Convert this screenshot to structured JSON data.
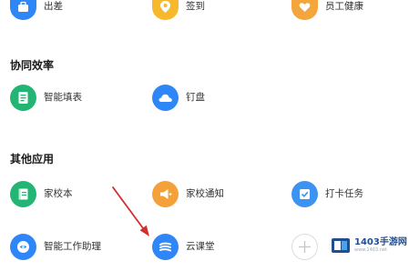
{
  "top_row": {
    "items": [
      {
        "label": "出差",
        "icon": "suitcase-icon",
        "color": "#2f86f6"
      },
      {
        "label": "签到",
        "icon": "location-pin-icon",
        "color": "#f5b92b"
      },
      {
        "label": "员工健康",
        "icon": "heart-shield-icon",
        "color": "#f4a63c"
      }
    ]
  },
  "sections": [
    {
      "title": "协同效率",
      "items": [
        {
          "label": "智能填表",
          "icon": "form-icon",
          "color": "#22b573"
        },
        {
          "label": "钉盘",
          "icon": "cloud-icon",
          "color": "#2f86f6"
        }
      ]
    },
    {
      "title": "其他应用",
      "items": [
        {
          "label": "家校本",
          "icon": "notebook-icon",
          "color": "#22b573"
        },
        {
          "label": "家校通知",
          "icon": "megaphone-icon",
          "color": "#f5a13a"
        },
        {
          "label": "打卡任务",
          "icon": "checkin-task-icon",
          "color": "#3c93f2"
        },
        {
          "label": "智能工作助理",
          "icon": "assistant-bot-icon",
          "color": "#2f86f6"
        },
        {
          "label": "云课堂",
          "icon": "cloud-classroom-icon",
          "color": "#2f86f6"
        },
        {
          "label": "",
          "icon": "plus-icon",
          "color": "#dcdcdc"
        }
      ]
    }
  ],
  "annotation": {
    "arrow_color": "#d0302e"
  },
  "watermark": {
    "name": "1403手游网",
    "url": "www.1403.net"
  }
}
